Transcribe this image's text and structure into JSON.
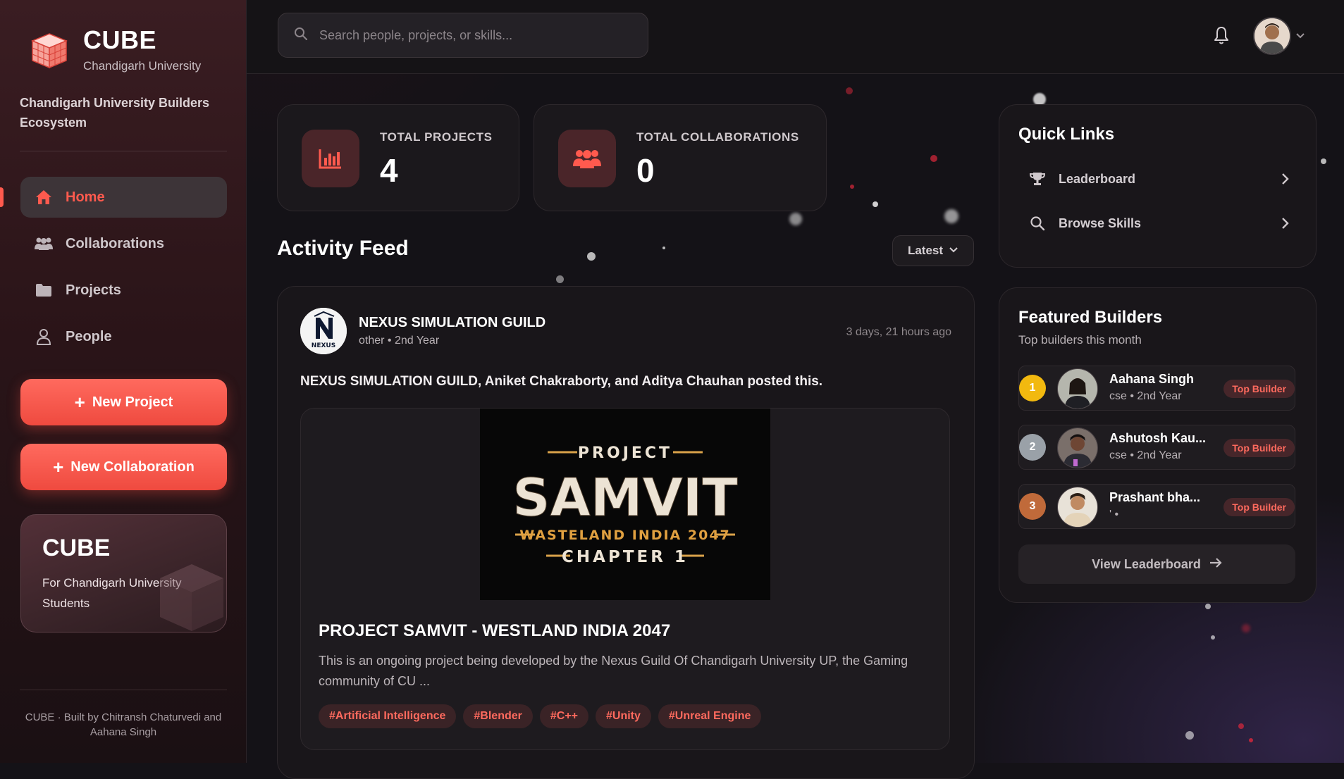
{
  "app": {
    "name": "CUBE",
    "university": "Chandigarh University",
    "tagline": "Chandigarh University Builders Ecosystem"
  },
  "nav": [
    {
      "label": "Home",
      "icon": "home-icon",
      "active": true
    },
    {
      "label": "Collaborations",
      "icon": "users-icon",
      "active": false
    },
    {
      "label": "Projects",
      "icon": "folder-icon",
      "active": false
    },
    {
      "label": "People",
      "icon": "person-icon",
      "active": false
    }
  ],
  "actions": {
    "new_project": "New Project",
    "new_collaboration": "New Collaboration"
  },
  "promo": {
    "title": "CUBE",
    "subtitle": "For Chandigarh University Students"
  },
  "footer": "CUBE · Built by Chitransh Chaturvedi and Aahana Singh",
  "search": {
    "placeholder": "Search people, projects, or skills..."
  },
  "stats": [
    {
      "label": "TOTAL PROJECTS",
      "value": "4",
      "icon": "bar-chart-icon"
    },
    {
      "label": "TOTAL COLLABORATIONS",
      "value": "0",
      "icon": "people-group-icon"
    }
  ],
  "feed": {
    "title": "Activity Feed",
    "sort": "Latest",
    "post": {
      "author": "NEXUS SIMULATION GUILD",
      "meta": "other • 2nd Year",
      "time": "3 days, 21 hours ago",
      "headline": "NEXUS SIMULATION GUILD, Aniket Chakraborty, and Aditya Chauhan posted this.",
      "logo_text": "NEXUS",
      "image": {
        "top": "PROJECT",
        "main": "SAMVIT",
        "sub": "WASTELAND INDIA 2047",
        "bottom": "CHAPTER 1"
      },
      "project_title": "PROJECT SAMVIT - WESTLAND INDIA 2047",
      "project_desc": "This is an ongoing project being developed by the Nexus Guild Of Chandigarh University UP, the Gaming community of CU ...",
      "tags": [
        "#Artificial Intelligence",
        "#Blender",
        "#C++",
        "#Unity",
        "#Unreal Engine"
      ]
    }
  },
  "quick_links": {
    "title": "Quick Links",
    "items": [
      {
        "label": "Leaderboard",
        "icon": "trophy-icon"
      },
      {
        "label": "Browse Skills",
        "icon": "search-icon"
      }
    ]
  },
  "featured": {
    "title": "Featured Builders",
    "subtitle": "Top builders this month",
    "builders": [
      {
        "rank": "1",
        "name": "Aahana Singh",
        "meta": "cse • 2nd Year",
        "badge": "Top Builder",
        "rank_color": "#f2b90f"
      },
      {
        "rank": "2",
        "name": "Ashutosh Kau...",
        "meta": "cse • 2nd Year",
        "badge": "Top Builder",
        "rank_color": "#9aa1a8"
      },
      {
        "rank": "3",
        "name": "Prashant bha...",
        "meta": "' •",
        "badge": "Top Builder",
        "rank_color": "#c06a3a"
      }
    ],
    "view_all": "View Leaderboard"
  },
  "colors": {
    "accent": "#ff5a4e",
    "bg": "#141217",
    "card": "#19161a"
  }
}
